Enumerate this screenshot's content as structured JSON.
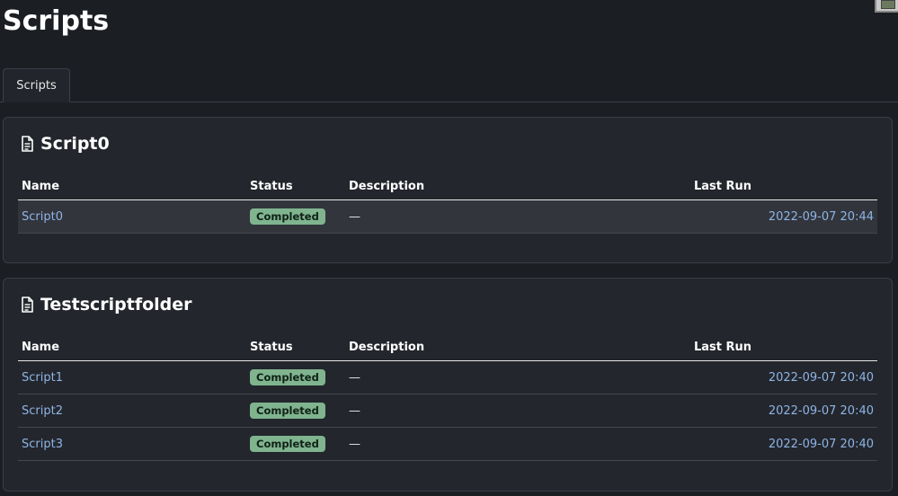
{
  "page": {
    "title": "Scripts"
  },
  "tabs": [
    {
      "label": "Scripts"
    }
  ],
  "table_headers": {
    "name": "Name",
    "status": "Status",
    "description": "Description",
    "last_run": "Last Run"
  },
  "folders": [
    {
      "title": "Script0",
      "rows": [
        {
          "name": "Script0",
          "status": "Completed",
          "description": "—",
          "last_run": "2022-09-07 20:44"
        }
      ]
    },
    {
      "title": "Testscriptfolder",
      "rows": [
        {
          "name": "Script1",
          "status": "Completed",
          "description": "—",
          "last_run": "2022-09-07 20:40"
        },
        {
          "name": "Script2",
          "status": "Completed",
          "description": "—",
          "last_run": "2022-09-07 20:40"
        },
        {
          "name": "Script3",
          "status": "Completed",
          "description": "—",
          "last_run": "2022-09-07 20:40"
        }
      ]
    }
  ],
  "colors": {
    "background": "#1b1e23",
    "card": "#23262c",
    "link": "#8eb4e6",
    "badge": "#7fb48f"
  },
  "icons": {
    "folder_header": "document-icon"
  }
}
